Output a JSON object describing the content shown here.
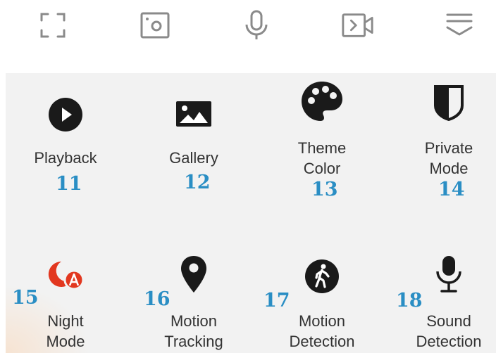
{
  "toolbar": {
    "icons": [
      "fullscreen-icon",
      "screenshot-icon",
      "microphone-icon",
      "record-video-icon",
      "collapse-menu-icon"
    ]
  },
  "tiles": [
    {
      "label": "Playback",
      "number": "11",
      "icon": "play-circle-icon"
    },
    {
      "label": "Gallery",
      "number": "12",
      "icon": "image-icon"
    },
    {
      "label": "Theme\nColor",
      "number": "13",
      "icon": "palette-icon"
    },
    {
      "label": "Private\nMode",
      "number": "14",
      "icon": "half-shield-icon"
    },
    {
      "label": "Night\nMode",
      "number": "15",
      "icon": "night-mode-icon"
    },
    {
      "label": "Motion\nTracking",
      "number": "16",
      "icon": "location-pin-icon"
    },
    {
      "label": "Motion\nDetection",
      "number": "17",
      "icon": "walking-person-icon"
    },
    {
      "label": "Sound\nDetection",
      "number": "18",
      "icon": "studio-microphone-icon"
    }
  ],
  "colors": {
    "icon_dark": "#1a1a1a",
    "icon_gray": "#8a8a8a",
    "night_mode_red": "#e2371f",
    "number_blue": "#2a8ec4",
    "panel_bg": "#f2f2f2"
  }
}
